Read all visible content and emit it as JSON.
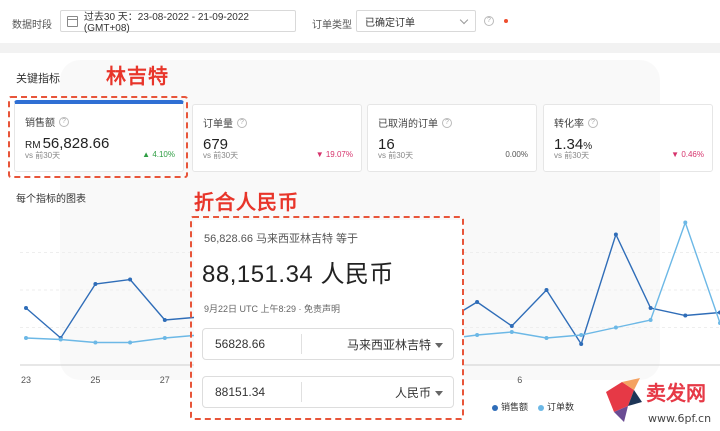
{
  "filters": {
    "date_label": "数据时段",
    "date_value": "过去30 天：23-08-2022 - 21-09-2022 (GMT+08)",
    "order_type_label": "订单类型",
    "order_type_value": "已确定订单"
  },
  "key_metrics": {
    "title": "关键指标",
    "cards": [
      {
        "label": "销售额",
        "currency": "RM",
        "value": "56,828.66",
        "compare": "vs 前30天",
        "change": "4.10%",
        "trend": "up"
      },
      {
        "label": "订单量",
        "currency": "",
        "value": "679",
        "compare": "vs 前30天",
        "change": "19.07%",
        "trend": "down"
      },
      {
        "label": "已取消的订单",
        "currency": "",
        "value": "16",
        "compare": "vs 前30天",
        "change": "0.00%",
        "trend": "neutral"
      },
      {
        "label": "转化率",
        "currency": "",
        "value": "1.34",
        "value_suffix": "%",
        "compare": "vs 前30天",
        "change": "0.46%",
        "trend": "down"
      }
    ]
  },
  "annotations": {
    "ringgit": "林吉特",
    "rmb": "折合人民币"
  },
  "chart_section_title": "每个指标的图表",
  "converter": {
    "source_text": "56,828.66 马来西亚林吉特 等于",
    "result_text": "88,151.34 人民币",
    "meta": "9月22日 UTC 上午8:29 · 免责声明",
    "from_amount": "56828.66",
    "from_currency": "马来西亚林吉特",
    "to_amount": "88151.34",
    "to_currency": "人民币"
  },
  "chart_data": {
    "type": "line",
    "x_tick_labels": [
      "23",
      "25",
      "27",
      "6"
    ],
    "series": [
      {
        "name": "销售额",
        "color": "#2f6db8",
        "points": [
          [
            0,
            0.62
          ],
          [
            1,
            0.82
          ],
          [
            2,
            0.46
          ],
          [
            3,
            0.43
          ],
          [
            4,
            0.7
          ],
          [
            5,
            0.68
          ],
          [
            11,
            0.37
          ],
          [
            12,
            0.72
          ],
          [
            13,
            0.58
          ],
          [
            14,
            0.74
          ],
          [
            15,
            0.5
          ],
          [
            16,
            0.86
          ],
          [
            17,
            0.13
          ],
          [
            18,
            0.62
          ],
          [
            19,
            0.67
          ],
          [
            20,
            0.65
          ]
        ]
      },
      {
        "name": "订单数",
        "color": "#6cb8e6",
        "points": [
          [
            0,
            0.82
          ],
          [
            1,
            0.83
          ],
          [
            2,
            0.85
          ],
          [
            3,
            0.85
          ],
          [
            4,
            0.82
          ],
          [
            5,
            0.8
          ],
          [
            11,
            0.82
          ],
          [
            12,
            0.83
          ],
          [
            13,
            0.8
          ],
          [
            14,
            0.78
          ],
          [
            15,
            0.82
          ],
          [
            16,
            0.8
          ],
          [
            17,
            0.75
          ],
          [
            18,
            0.7
          ],
          [
            19,
            0.05
          ],
          [
            20,
            0.72
          ]
        ]
      }
    ]
  },
  "legend": {
    "sales": "销售额",
    "orders": "订单数"
  },
  "logo": {
    "brand": "卖发网",
    "url": "www.6pf.cn"
  }
}
